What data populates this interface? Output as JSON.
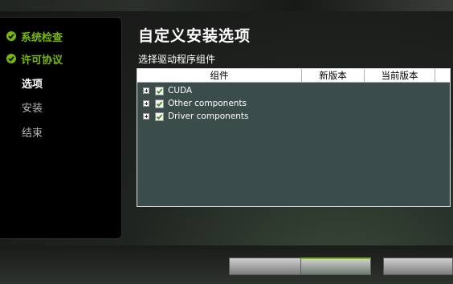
{
  "sidebar": {
    "steps": [
      {
        "label": "系统检查",
        "state": "done"
      },
      {
        "label": "许可协议",
        "state": "done"
      },
      {
        "label": "选项",
        "state": "current"
      },
      {
        "label": "安装",
        "state": "todo"
      },
      {
        "label": "结束",
        "state": "todo"
      }
    ]
  },
  "main": {
    "title": "自定义安装选项",
    "subtitle": "选择驱动程序组件",
    "columns": [
      "组件",
      "新版本",
      "当前版本"
    ],
    "components": [
      {
        "label": "CUDA",
        "checked": true
      },
      {
        "label": "Other components",
        "checked": true
      },
      {
        "label": "Driver components",
        "checked": true
      }
    ]
  },
  "colors": {
    "accent": "#76b900",
    "panel": "#3a4d4a"
  }
}
